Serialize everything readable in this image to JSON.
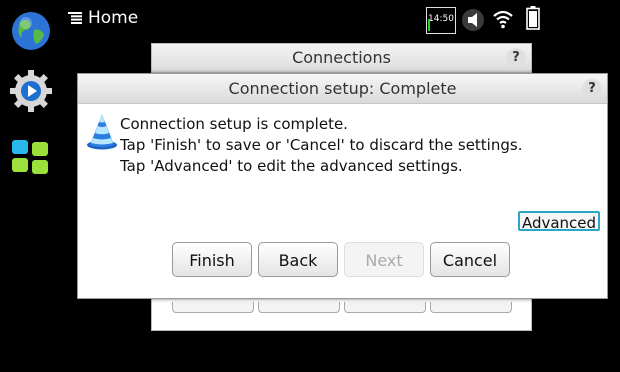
{
  "status_bar": {
    "title": "Home",
    "clock": "14:50"
  },
  "icons": {
    "menu": "menu-icon",
    "globe": "globe-icon",
    "settings": "settings-icon",
    "apps": "app-grid-icon",
    "volume": "volume-icon",
    "wifi": "wifi-icon",
    "battery": "battery-icon",
    "cone": "setup-wizard-icon",
    "help": "help-icon"
  },
  "background_dialog": {
    "title": "Connections",
    "help": "?"
  },
  "dialog": {
    "title": "Connection setup: Complete",
    "help": "?",
    "message": [
      "Connection setup is complete.",
      "Tap 'Finish' to save or 'Cancel' to discard the settings.",
      "Tap 'Advanced' to edit the advanced settings."
    ],
    "advanced_label": "Advanced",
    "buttons": {
      "finish": "Finish",
      "back": "Back",
      "next": "Next",
      "cancel": "Cancel"
    }
  },
  "colors": {
    "focus": "#2aa7c8",
    "background": "#000000"
  }
}
